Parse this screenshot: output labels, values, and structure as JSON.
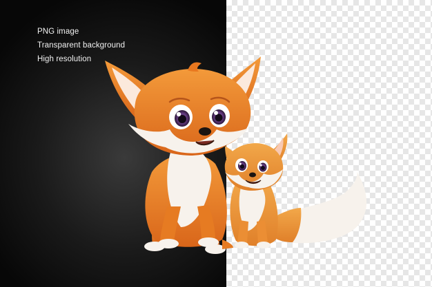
{
  "captions": [
    "PNG image",
    "Transparent background",
    "High resolution"
  ],
  "colors": {
    "dark_panel": "#111111",
    "fox_orange": "#e97a1c",
    "fur_white": "#f7f2ec",
    "checker_gray": "#e6e6e6"
  },
  "subjects": [
    "large cartoon fox",
    "small cartoon fox cub"
  ]
}
